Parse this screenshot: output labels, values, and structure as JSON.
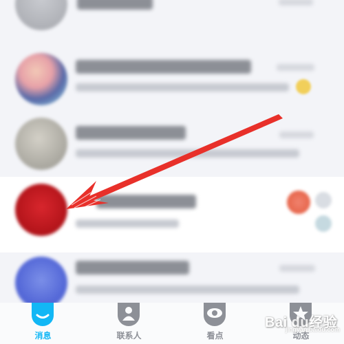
{
  "tabbar": {
    "tabs": [
      {
        "label": "消息",
        "icon": "chat-bubble-icon",
        "active": true
      },
      {
        "label": "联系人",
        "icon": "contacts-icon",
        "active": false
      },
      {
        "label": "看点",
        "icon": "eye-icon",
        "active": false
      },
      {
        "label": "动态",
        "icon": "star-icon",
        "active": false
      }
    ]
  },
  "watermark": {
    "text": "Bai du经验",
    "sub": "jingyan.baidu.com"
  },
  "colors": {
    "accent": "#12b7f5",
    "arrow": "#e8302a",
    "highlight_row": "#ffffff"
  }
}
